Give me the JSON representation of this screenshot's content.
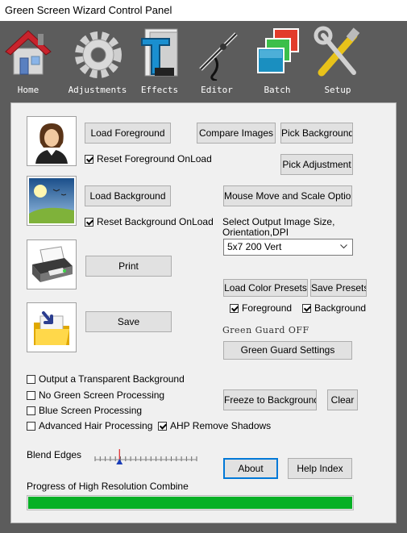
{
  "window": {
    "title": "Green Screen Wizard Control Panel"
  },
  "toolbar": {
    "items": [
      {
        "label": "Home",
        "icon": "house-icon"
      },
      {
        "label": "Adjustments",
        "icon": "gear-icon"
      },
      {
        "label": "Effects",
        "icon": "effects-icon"
      },
      {
        "label": "Editor",
        "icon": "airbrush-icon"
      },
      {
        "label": "Batch",
        "icon": "stacked-images-icon"
      },
      {
        "label": "Setup",
        "icon": "tools-icon"
      }
    ]
  },
  "foreground": {
    "button": "Load Foreground",
    "reset_label": "Reset Foreground OnLoad",
    "reset_checked": true
  },
  "background": {
    "button": "Load Background",
    "reset_label": "Reset Background OnLoad",
    "reset_checked": true
  },
  "print": {
    "button": "Print"
  },
  "save": {
    "button": "Save"
  },
  "buttons": {
    "compare": "Compare Images",
    "pick_background": "Pick Background",
    "pick_adjustment": "Pick Adjustment",
    "mouse_move": "Mouse Move and Scale Options",
    "load_presets": "Load Color Presets",
    "save_presets": "Save Presets",
    "green_guard_settings": "Green Guard Settings",
    "freeze": "Freeze to Background",
    "clear": "Clear",
    "about": "About",
    "help": "Help Index"
  },
  "output": {
    "label": "Select Output Image Size,\nOrientation,DPI",
    "selected": "5x7 200 Vert"
  },
  "presets": {
    "foreground_label": "Foreground",
    "foreground_checked": true,
    "background_label": "Background",
    "background_checked": true
  },
  "green_guard_status": "Green Guard OFF",
  "options": [
    {
      "label": "Output a Transparent Background",
      "checked": false
    },
    {
      "label": "No Green Screen Processing",
      "checked": false
    },
    {
      "label": "Blue Screen Processing",
      "checked": false
    },
    {
      "label": "Advanced Hair Processing",
      "checked": false
    }
  ],
  "ahp": {
    "label": "AHP Remove Shadows",
    "checked": true
  },
  "blend": {
    "label": "Blend Edges",
    "value_fraction": 0.24
  },
  "progress": {
    "label": "Progress of High Resolution Combine",
    "value_percent": 100,
    "color": "#06b025"
  }
}
